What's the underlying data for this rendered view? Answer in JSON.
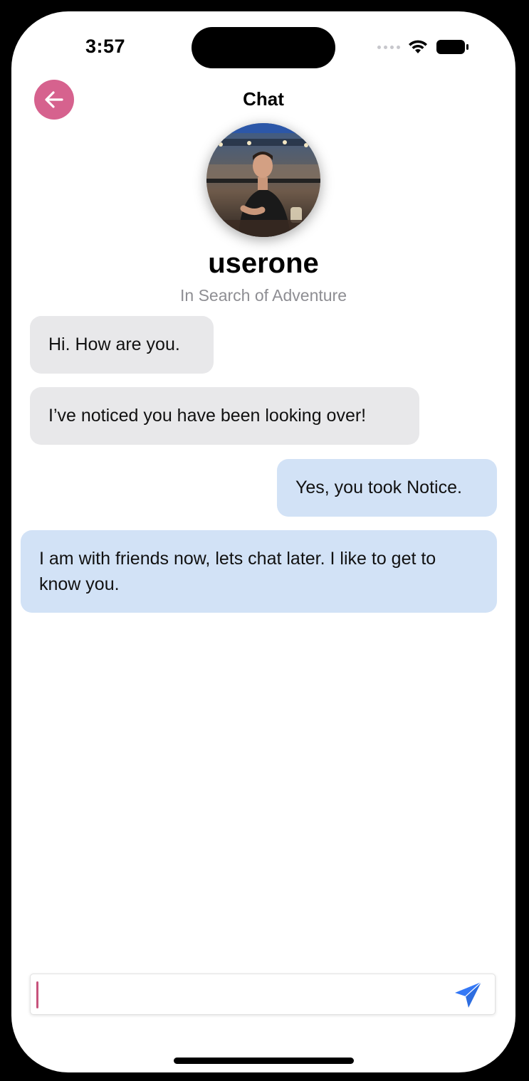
{
  "status_bar": {
    "time": "3:57",
    "icons": [
      "cellular-signal-icon",
      "wifi-icon",
      "battery-icon"
    ]
  },
  "header": {
    "back_icon": "arrow-left-icon",
    "title": "Chat"
  },
  "profile": {
    "username": "userone",
    "tagline": "In Search of Adventure"
  },
  "messages": [
    {
      "direction": "incoming",
      "text": "Hi. How are you."
    },
    {
      "direction": "incoming",
      "text": "I’ve noticed you have been looking over!"
    },
    {
      "direction": "outgoing",
      "text": "Yes, you took Notice."
    },
    {
      "direction": "outgoing",
      "text": "I am with friends now, lets chat later. I like to get to know you."
    }
  ],
  "composer": {
    "value": "",
    "send_icon": "paper-plane-icon"
  },
  "colors": {
    "accent": "#d6628e",
    "incoming_bubble": "#e8e8ea",
    "outgoing_bubble": "#d2e2f6",
    "send_icon": "#3478f6"
  }
}
